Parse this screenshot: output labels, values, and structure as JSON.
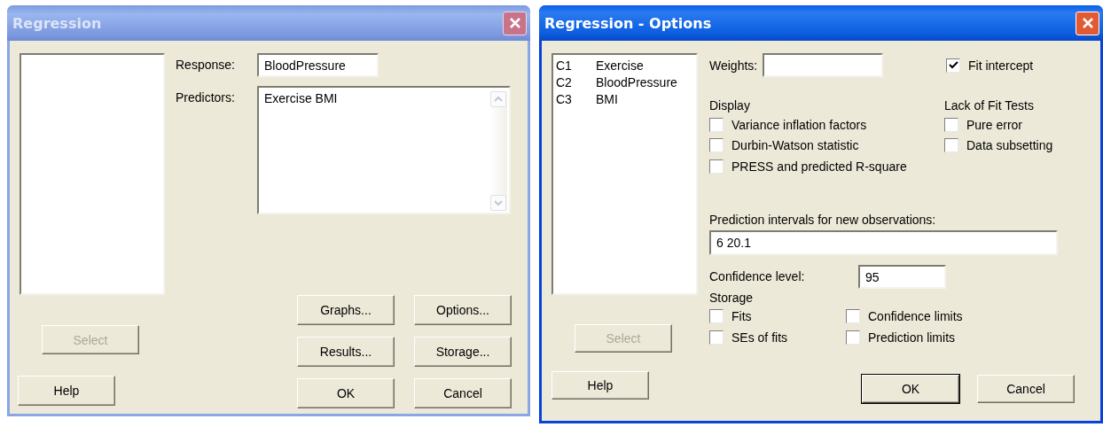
{
  "regression": {
    "title": "Regression",
    "active": false,
    "response": {
      "label": "Response:",
      "value": "BloodPressure"
    },
    "predictors": {
      "label": "Predictors:",
      "value": "Exercise BMI"
    },
    "select_button": {
      "label": "Select",
      "disabled": true
    },
    "help_button": {
      "label": "Help"
    },
    "buttons": [
      {
        "label": "Graphs..."
      },
      {
        "label": "Options..."
      },
      {
        "label": "Results..."
      },
      {
        "label": "Storage..."
      },
      {
        "label": "OK"
      },
      {
        "label": "Cancel"
      }
    ]
  },
  "options": {
    "title": "Regression - Options",
    "active": true,
    "columns": [
      {
        "id": "C1",
        "name": "Exercise"
      },
      {
        "id": "C2",
        "name": "BloodPressure"
      },
      {
        "id": "C3",
        "name": "BMI"
      }
    ],
    "weights": {
      "label": "Weights:"
    },
    "fit_intercept": {
      "label": "Fit intercept",
      "checked": true
    },
    "display": {
      "title": "Display",
      "options": [
        {
          "label": "Variance inflation factors",
          "checked": false
        },
        {
          "label": "Durbin-Watson statistic",
          "checked": false
        },
        {
          "label": "PRESS and predicted R-square",
          "checked": false
        }
      ]
    },
    "lack_of_fit": {
      "title": "Lack of Fit Tests",
      "options": [
        {
          "label": "Pure error",
          "checked": false
        },
        {
          "label": "Data subsetting",
          "checked": false
        }
      ]
    },
    "prediction": {
      "label": "Prediction intervals for new observations:",
      "value": "6 20.1"
    },
    "confidence": {
      "label": "Confidence level:",
      "value": "95"
    },
    "storage": {
      "title": "Storage",
      "options": [
        {
          "label": "Fits",
          "checked": false
        },
        {
          "label": "Confidence limits",
          "checked": false
        },
        {
          "label": "SEs of fits",
          "checked": false
        },
        {
          "label": "Prediction limits",
          "checked": false
        }
      ]
    },
    "select_button": {
      "label": "Select",
      "disabled": true
    },
    "help_button": {
      "label": "Help"
    },
    "buttons": [
      {
        "label": "OK",
        "default": true
      },
      {
        "label": "Cancel",
        "default": false
      }
    ]
  }
}
